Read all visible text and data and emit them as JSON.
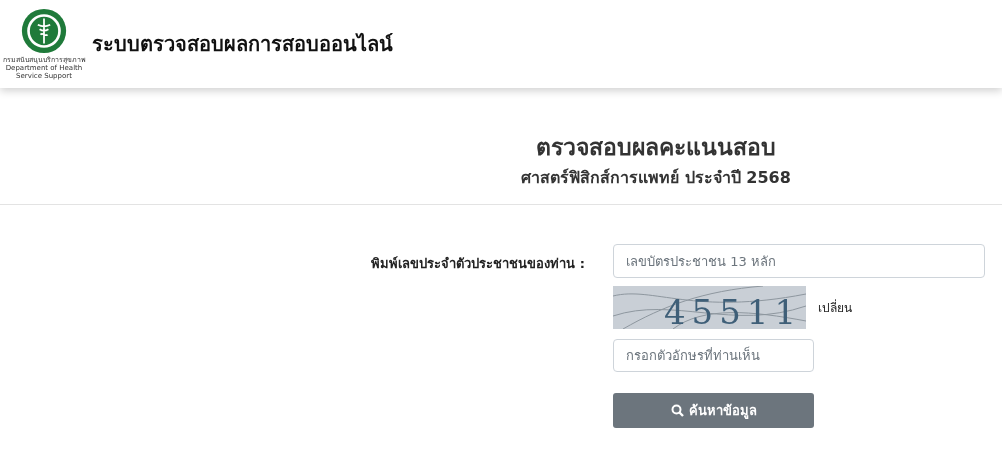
{
  "header": {
    "logo_caption": [
      "กรมสนับสนุนบริการสุขภาพ",
      "Department of Health Service Support"
    ],
    "title": "ระบบตรวจสอบผลการสอบออนไลน์"
  },
  "heading": {
    "title": "ตรวจสอบผลคะแนนสอบ",
    "subtitle": "ศาสตร์ฟิสิกส์การแพทย์ ประจำปี 2568"
  },
  "form": {
    "id_label": "พิมพ์เลขประจำตัวประชาชนของท่าน :",
    "id_field": {
      "placeholder": "เลขบัตรประชาชน 13 หลัก"
    },
    "captcha": {
      "code": "45511",
      "refresh_link": "เปลี่ยน"
    },
    "captcha_field": {
      "placeholder": "กรอกตัวอักษรที่ท่านเห็น"
    },
    "search_button": "ค้นหาข้อมูล"
  }
}
